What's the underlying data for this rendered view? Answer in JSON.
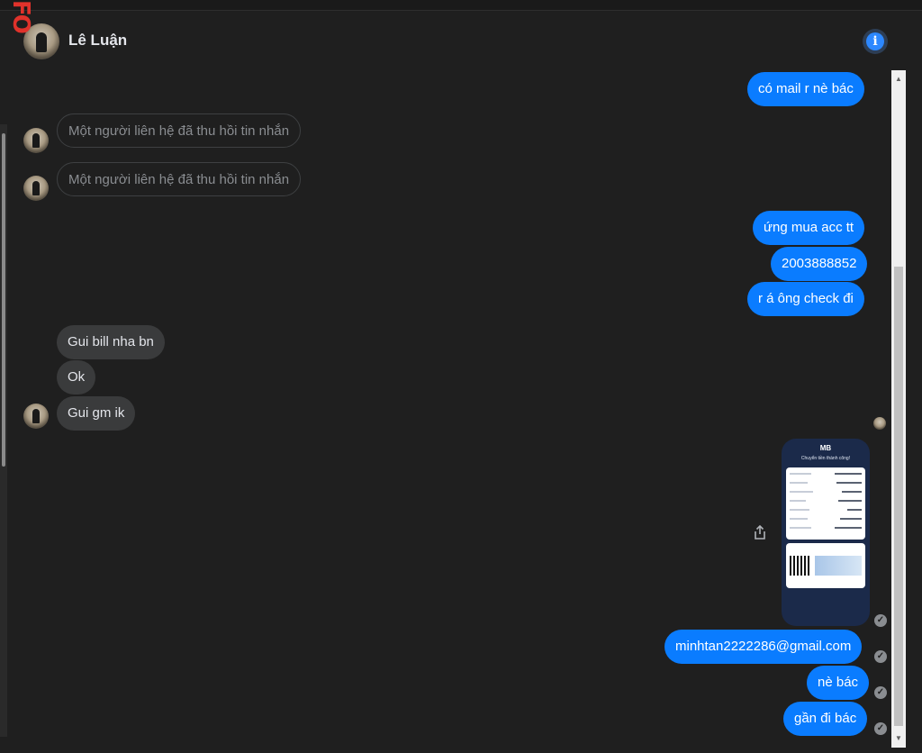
{
  "header": {
    "contact_name": "Lê Luận",
    "info_icon": "info-icon"
  },
  "overlay_mark": "FO",
  "messages": {
    "m1": "có mail r nè bác",
    "unsent1": "Một người liên hệ đã thu hồi tin nhắn",
    "unsent2": "Một người liên hệ đã thu hồi tin nhắn",
    "m2": "ứng mua acc tt",
    "m3": "2003888852",
    "m4": "r á ông check đi",
    "m5": "Gui bill nha bn",
    "m6": "Ok",
    "m7": "Gui gm ik",
    "m8": "minhtan2222286@gmail.com",
    "m9": "nè bác",
    "m10": "gần đi bác"
  },
  "receipt": {
    "brand": "MB",
    "title": "Chuyển tiền thành công!"
  },
  "colors": {
    "outgoing": "#0a7cff",
    "incoming": "#3a3b3c",
    "background": "#1f1f1f"
  }
}
